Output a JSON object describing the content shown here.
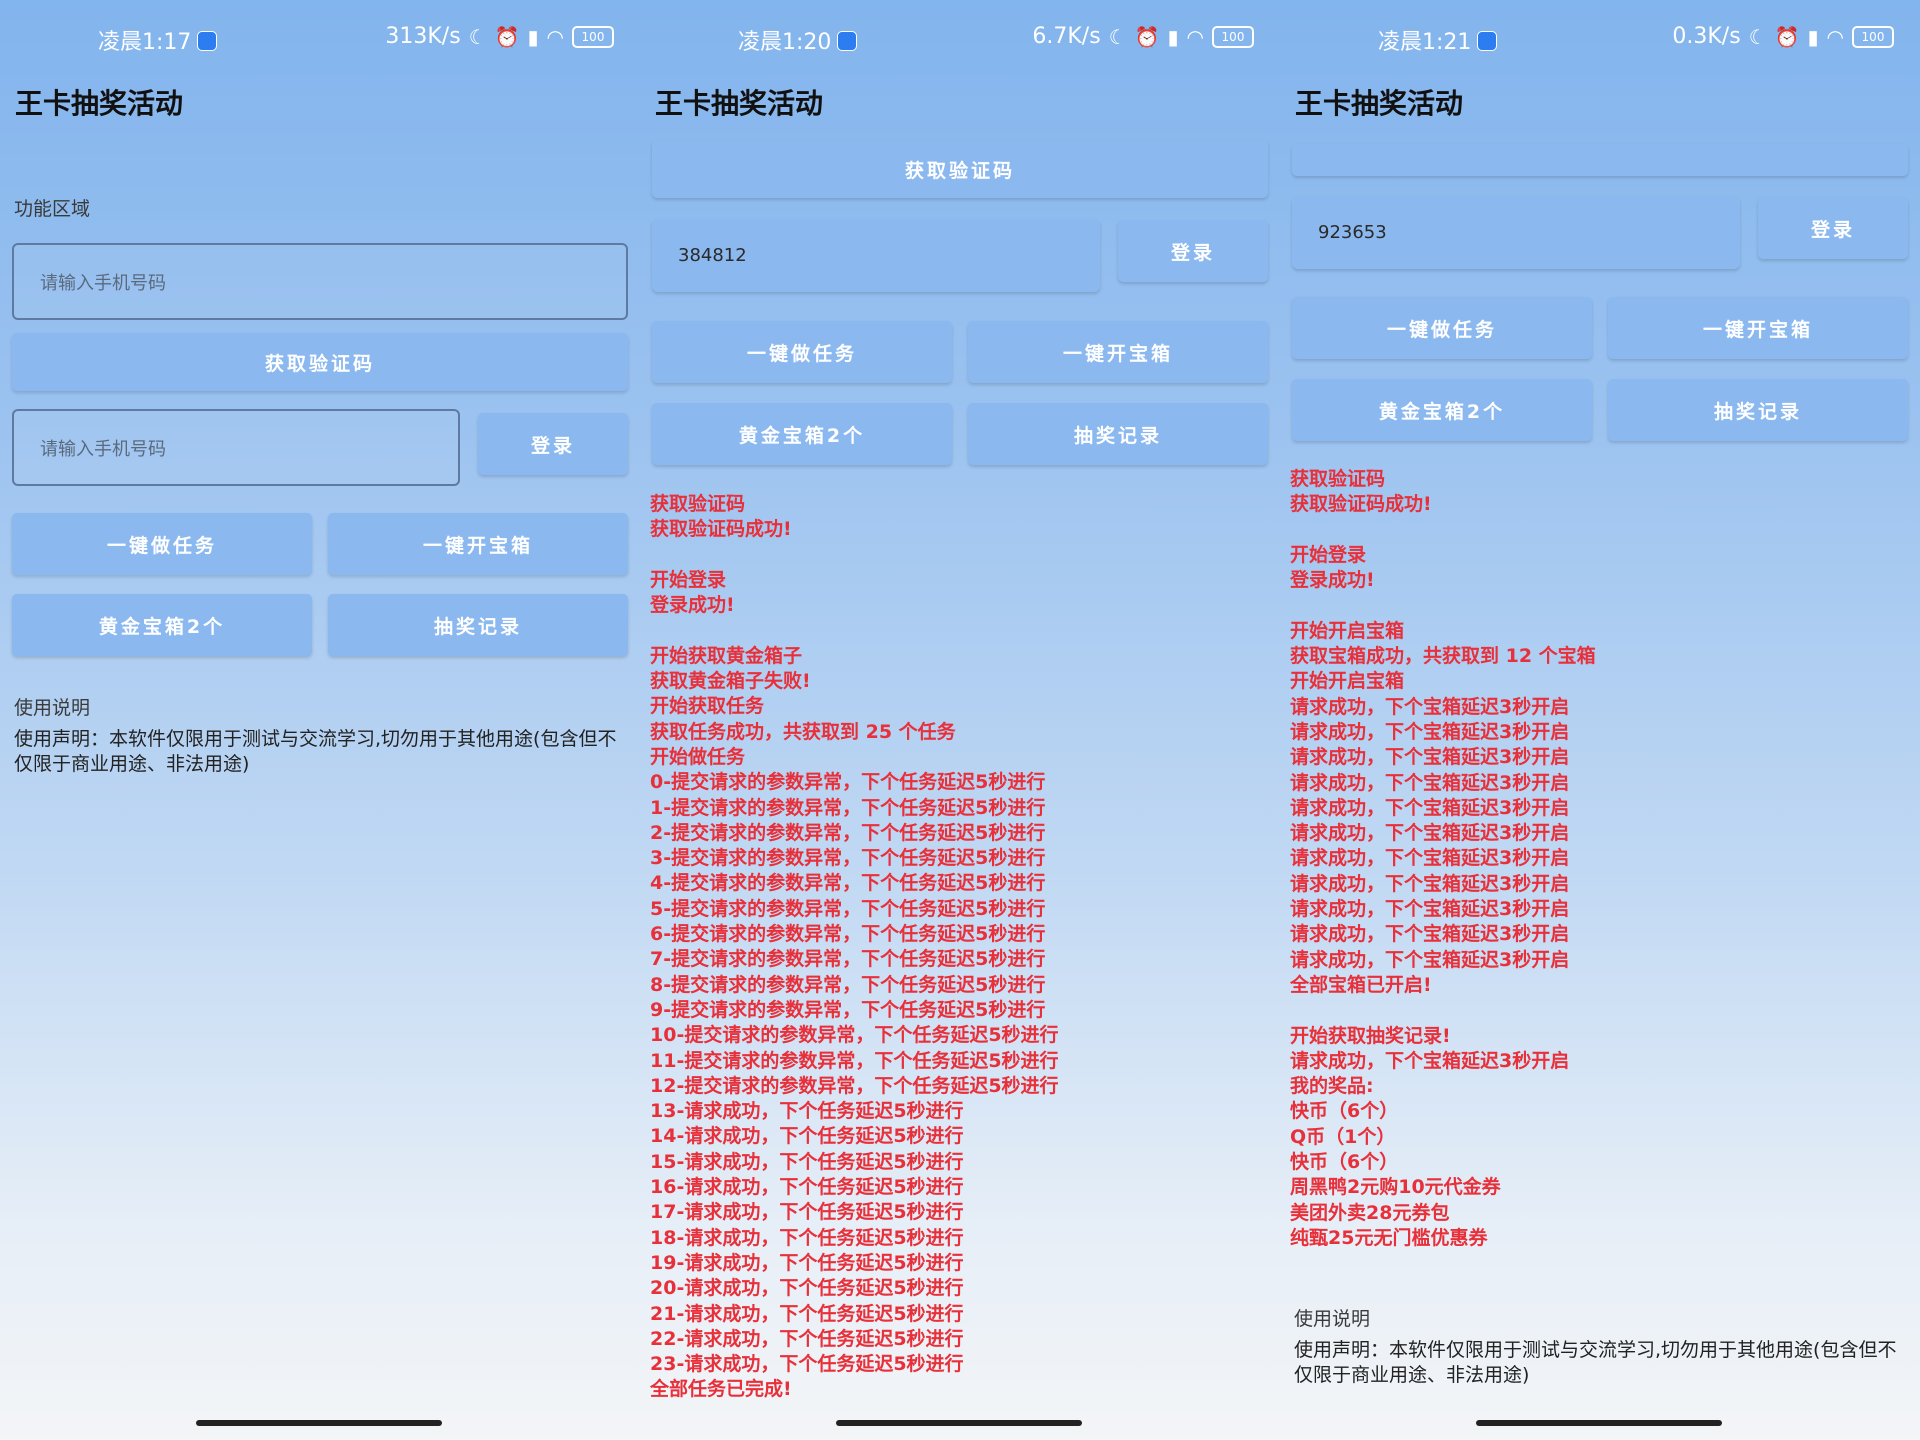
{
  "app_title": "王卡抽奖活动",
  "status": {
    "p1": {
      "time": "凌晨1:17",
      "speed": "313K/s",
      "battery": "100"
    },
    "p2": {
      "time": "凌晨1:20",
      "speed": "6.7K/s",
      "battery": "100"
    },
    "p3": {
      "time": "凌晨1:21",
      "speed": "0.3K/s",
      "battery": "100"
    }
  },
  "labels": {
    "function_area": "功能区域",
    "phone_placeholder": "请输入手机号码",
    "get_code": "获取验证码",
    "login": "登录",
    "do_tasks": "一键做任务",
    "open_boxes": "一键开宝箱",
    "gold_box": "黄金宝箱2个",
    "lottery_record": "抽奖记录",
    "usage_title": "使用说明",
    "usage_text": "使用声明：本软件仅限用于测试与交流学习,切勿用于其他用途(包含但不仅限于商业用途、非法用途)"
  },
  "panel2": {
    "code_value": "384812",
    "log": [
      "获取验证码",
      "获取验证码成功!",
      "",
      "开始登录",
      "登录成功!",
      "",
      "开始获取黄金箱子",
      "获取黄金箱子失败!",
      "开始获取任务",
      "获取任务成功，共获取到 25 个任务",
      "开始做任务",
      "0-提交请求的参数异常，下个任务延迟5秒进行",
      "1-提交请求的参数异常，下个任务延迟5秒进行",
      "2-提交请求的参数异常，下个任务延迟5秒进行",
      "3-提交请求的参数异常，下个任务延迟5秒进行",
      "4-提交请求的参数异常，下个任务延迟5秒进行",
      "5-提交请求的参数异常，下个任务延迟5秒进行",
      "6-提交请求的参数异常，下个任务延迟5秒进行",
      "7-提交请求的参数异常，下个任务延迟5秒进行",
      "8-提交请求的参数异常，下个任务延迟5秒进行",
      "9-提交请求的参数异常，下个任务延迟5秒进行",
      "10-提交请求的参数异常，下个任务延迟5秒进行",
      "11-提交请求的参数异常，下个任务延迟5秒进行",
      "12-提交请求的参数异常，下个任务延迟5秒进行",
      "13-请求成功，下个任务延迟5秒进行",
      "14-请求成功，下个任务延迟5秒进行",
      "15-请求成功，下个任务延迟5秒进行",
      "16-请求成功，下个任务延迟5秒进行",
      "17-请求成功，下个任务延迟5秒进行",
      "18-请求成功，下个任务延迟5秒进行",
      "19-请求成功，下个任务延迟5秒进行",
      "20-请求成功，下个任务延迟5秒进行",
      "21-请求成功，下个任务延迟5秒进行",
      "22-请求成功，下个任务延迟5秒进行",
      "23-请求成功，下个任务延迟5秒进行",
      "全部任务已完成!"
    ]
  },
  "panel3": {
    "code_value": "923653",
    "log": [
      "获取验证码",
      "获取验证码成功!",
      "",
      "开始登录",
      "登录成功!",
      "",
      "开始开启宝箱",
      "获取宝箱成功，共获取到 12 个宝箱",
      "开始开启宝箱",
      "请求成功，下个宝箱延迟3秒开启",
      "请求成功，下个宝箱延迟3秒开启",
      "请求成功，下个宝箱延迟3秒开启",
      "请求成功，下个宝箱延迟3秒开启",
      "请求成功，下个宝箱延迟3秒开启",
      "请求成功，下个宝箱延迟3秒开启",
      "请求成功，下个宝箱延迟3秒开启",
      "请求成功，下个宝箱延迟3秒开启",
      "请求成功，下个宝箱延迟3秒开启",
      "请求成功，下个宝箱延迟3秒开启",
      "请求成功，下个宝箱延迟3秒开启",
      "全部宝箱已开启!",
      "",
      "开始获取抽奖记录!",
      "请求成功，下个宝箱延迟3秒开启",
      "我的奖品:",
      "快币（6个）",
      "Q币（1个）",
      "快币（6个）",
      "周黑鸭2元购10元代金券",
      "美团外卖28元券包",
      "纯甄25元无门槛优惠券"
    ]
  }
}
